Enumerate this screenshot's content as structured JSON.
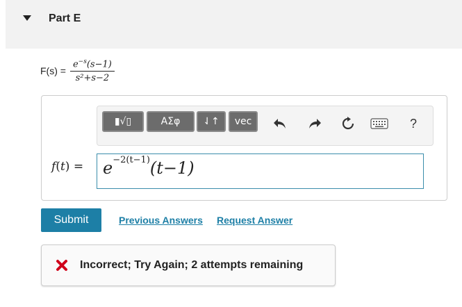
{
  "part": {
    "title": "Part E"
  },
  "given": {
    "lhs": "F(s) =",
    "numerator": "e−s(s−1)",
    "denominator": "s²+s−2"
  },
  "toolbar": {
    "templates_label": "▮√▯",
    "greek_label": "ΑΣφ",
    "arrows_label": "⇃↑",
    "vec_label": "vec",
    "help_label": "?"
  },
  "answer": {
    "label": "f(t) =",
    "expression": "e−2(t−1)(t−1)",
    "border_color": "#3a8dab"
  },
  "actions": {
    "submit_label": "Submit",
    "previous_answers_label": "Previous Answers",
    "request_answer_label": "Request Answer"
  },
  "feedback": {
    "text": "Incorrect; Try Again; 2 attempts remaining",
    "icon": "x-icon",
    "icon_color": "#d0021b"
  },
  "colors": {
    "accent": "#1d7fa6",
    "header_bg": "#f2f2f2"
  }
}
